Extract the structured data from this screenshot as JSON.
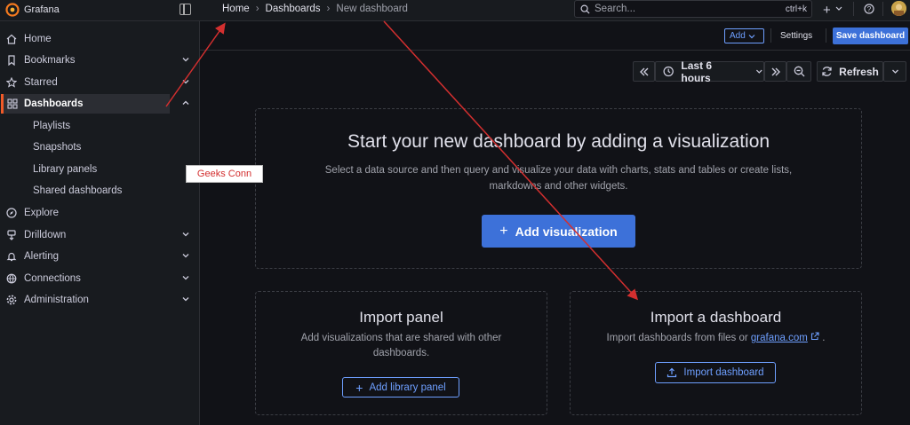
{
  "app": {
    "name": "Grafana"
  },
  "breadcrumb": {
    "home": "Home",
    "sep": "›",
    "dashboards": "Dashboards",
    "current": "New dashboard"
  },
  "search": {
    "placeholder": "Search...",
    "shortcut": "ctrl+k"
  },
  "topbar": {
    "plus": "+"
  },
  "sidebar": {
    "items": [
      {
        "label": "Home",
        "icon": "home-icon"
      },
      {
        "label": "Bookmarks",
        "icon": "bookmark-icon"
      },
      {
        "label": "Starred",
        "icon": "star-icon"
      },
      {
        "label": "Dashboards",
        "icon": "apps-icon",
        "active": true
      },
      {
        "label": "Explore",
        "icon": "compass-icon"
      },
      {
        "label": "Drilldown",
        "icon": "drilldown-icon"
      },
      {
        "label": "Alerting",
        "icon": "bell-icon"
      },
      {
        "label": "Connections",
        "icon": "connections-icon"
      },
      {
        "label": "Administration",
        "icon": "cog-icon"
      }
    ],
    "subitems": [
      "Playlists",
      "Snapshots",
      "Library panels",
      "Shared dashboards"
    ]
  },
  "toolbar": {
    "add_label": "Add",
    "settings_label": "Settings",
    "save_label": "Save dashboard"
  },
  "timepicker": {
    "range_label": "Last 6 hours",
    "refresh_label": "Refresh"
  },
  "main": {
    "hero_title": "Start your new dashboard by adding a visualization",
    "hero_text_1": "Select a data source and then query and visualize your data with charts, stats and tables or create lists,",
    "hero_text_2": "markdowns and other widgets.",
    "add_viz_label": "Add visualization",
    "import_panel_title": "Import panel",
    "import_panel_text_1": "Add visualizations that are shared with other",
    "import_panel_text_2": "dashboards.",
    "add_library_label": "Add library panel",
    "import_dash_title": "Import a dashboard",
    "import_dash_text": "Import dashboards from files or",
    "import_dash_link": "grafana.com",
    "import_dash_period": ".",
    "import_dash_button": "Import dashboard"
  },
  "annotation": {
    "label": "Geeks Conn"
  },
  "colors": {
    "accent": "#3d71d9",
    "active_border": "#f05a28",
    "arrow": "#d32f2f"
  }
}
